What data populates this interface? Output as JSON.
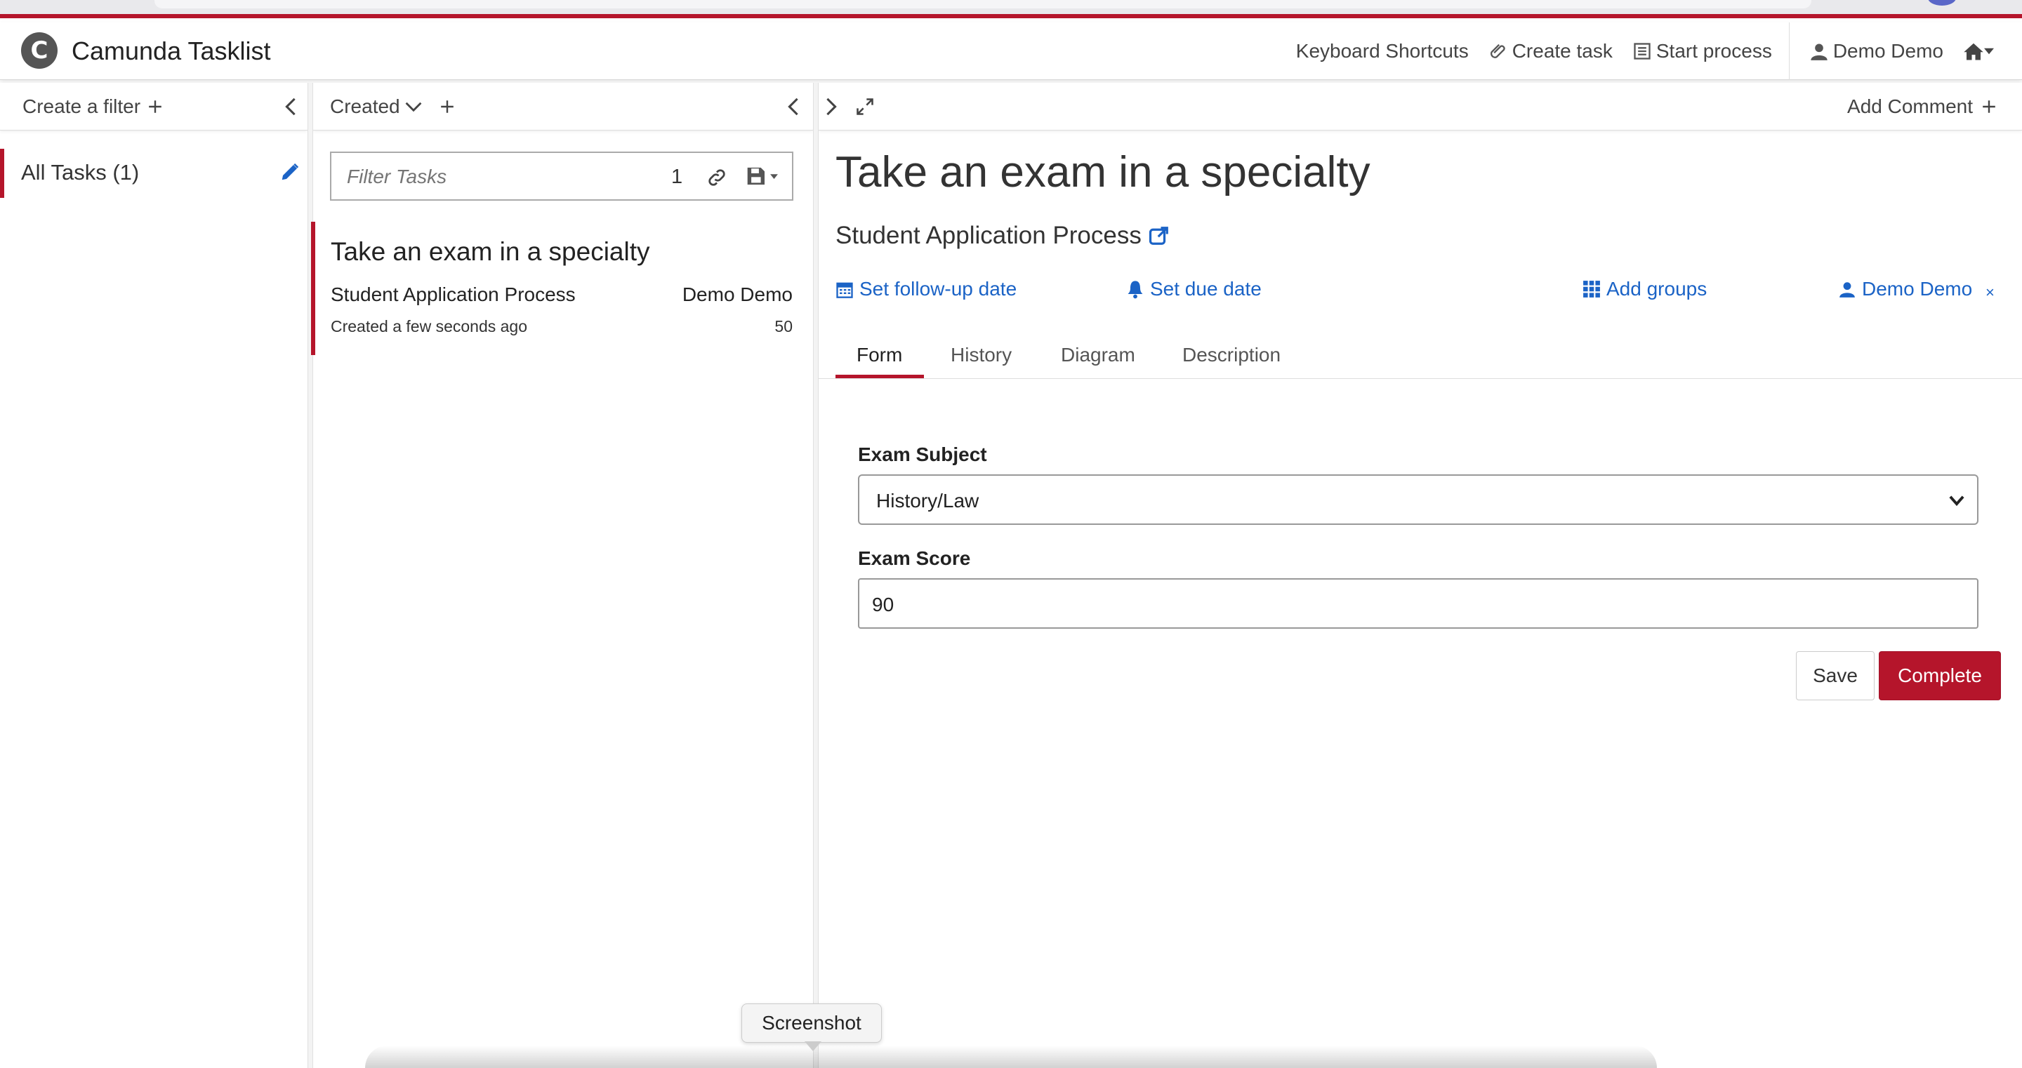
{
  "app": {
    "title": "Camunda Tasklist",
    "logo_letter": "C"
  },
  "navbar": {
    "keyboard_shortcuts": "Keyboard Shortcuts",
    "create_task": "Create task",
    "start_process": "Start process",
    "user": "Demo Demo"
  },
  "filters": {
    "create_label": "Create a filter",
    "items": [
      {
        "label": "All Tasks (1)"
      }
    ]
  },
  "list": {
    "sort_label": "Created",
    "filter_placeholder": "Filter Tasks",
    "result_count": "1",
    "tasks": [
      {
        "title": "Take an exam in a specialty",
        "process": "Student Application Process",
        "assignee": "Demo Demo",
        "created": "Created a few seconds ago",
        "priority": "50"
      }
    ]
  },
  "detail": {
    "add_comment": "Add Comment",
    "title": "Take an exam in a specialty",
    "process": "Student Application Process",
    "actions": {
      "follow_up": "Set follow-up date",
      "due_date": "Set due date",
      "add_groups": "Add groups",
      "assignee": "Demo Demo",
      "unassign": "×"
    },
    "tabs": [
      "Form",
      "History",
      "Diagram",
      "Description"
    ],
    "active_tab": "Form",
    "form": {
      "exam_subject_label": "Exam Subject",
      "exam_subject_value": "History/Law",
      "exam_score_label": "Exam Score",
      "exam_score_value": "90"
    },
    "buttons": {
      "save": "Save",
      "complete": "Complete"
    }
  },
  "tooltip": {
    "text": "Screenshot"
  },
  "colors": {
    "brand": "#b5152b",
    "link": "#1b63c6"
  }
}
